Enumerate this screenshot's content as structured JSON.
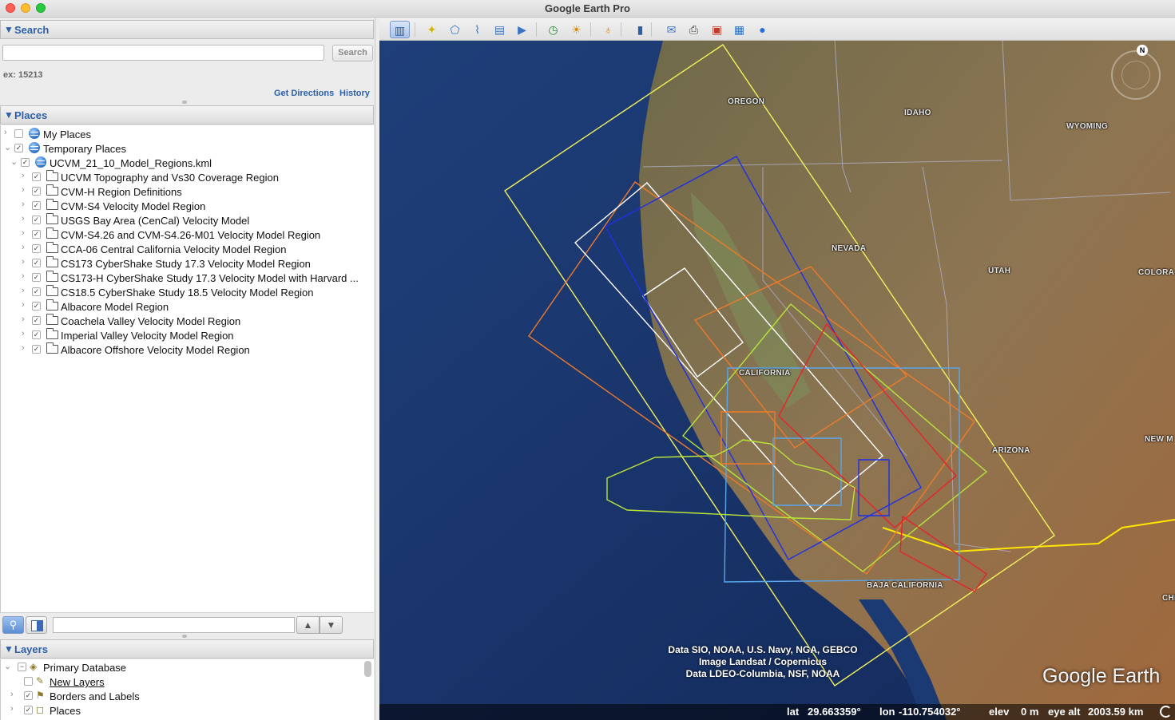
{
  "window": {
    "title": "Google Earth Pro"
  },
  "search": {
    "header": "Search",
    "placeholder": "",
    "button": "Search",
    "hint": "ex: 15213",
    "get_directions": "Get Directions",
    "history": "History"
  },
  "places": {
    "header": "Places",
    "items": [
      {
        "label": "My Places",
        "level": 0,
        "icon": "my-places-globe-icon",
        "expanded": false
      },
      {
        "label": "Temporary Places",
        "level": 0,
        "icon": "temporary-places-icon",
        "expanded": true
      },
      {
        "label": "UCVM_21_10_Model_Regions.kml",
        "level": 1,
        "icon": "kml-globe-icon",
        "expanded": true
      },
      {
        "label": "UCVM Topography and Vs30 Coverage Region",
        "level": 2,
        "icon": "folder-icon"
      },
      {
        "label": "CVM-H Region Definitions",
        "level": 2,
        "icon": "folder-icon"
      },
      {
        "label": "CVM-S4 Velocity Model Region",
        "level": 2,
        "icon": "folder-icon"
      },
      {
        "label": "USGS Bay Area (CenCal) Velocity Model",
        "level": 2,
        "icon": "folder-icon"
      },
      {
        "label": "CVM-S4.26 and CVM-S4.26-M01 Velocity Model Region",
        "level": 2,
        "icon": "folder-icon"
      },
      {
        "label": "CCA-06 Central California Velocity Model Region",
        "level": 2,
        "icon": "folder-icon"
      },
      {
        "label": "CS173 CyberShake Study 17.3 Velocity Model Region",
        "level": 2,
        "icon": "folder-icon"
      },
      {
        "label": "CS173-H CyberShake Study 17.3 Velocity Model with Harvard ...",
        "level": 2,
        "icon": "folder-icon"
      },
      {
        "label": "CS18.5 CyberShake Study 18.5 Velocity Model Region",
        "level": 2,
        "icon": "folder-icon"
      },
      {
        "label": "Albacore Model Region",
        "level": 2,
        "icon": "folder-icon"
      },
      {
        "label": "Coachela Valley Velocity Model Region",
        "level": 2,
        "icon": "folder-icon"
      },
      {
        "label": "Imperial Valley Velocity Model Region",
        "level": 2,
        "icon": "folder-icon"
      },
      {
        "label": "Albacore Offshore Velocity Model Region",
        "level": 2,
        "icon": "folder-icon"
      }
    ]
  },
  "layers": {
    "header": "Layers",
    "items": [
      {
        "label": "Primary Database",
        "level": 0,
        "icon": "database-layers-icon",
        "link": false
      },
      {
        "label": "New Layers",
        "level": 1,
        "icon": "pencil-icon",
        "link": true
      },
      {
        "label": "Borders and Labels",
        "level": 1,
        "icon": "flag-icon",
        "link": false
      },
      {
        "label": "Places",
        "level": 1,
        "icon": "places-icon",
        "link": false
      }
    ]
  },
  "toolbar": {
    "icons": [
      "sidebar-toggle-icon",
      "placemark-icon",
      "polygon-icon",
      "path-icon",
      "overlay-icon",
      "tour-icon",
      "historical-imagery-icon",
      "sunlight-icon",
      "planets-icon",
      "ruler-icon",
      "email-icon",
      "print-icon",
      "save-image-icon",
      "map-icon",
      "google-earth-icon"
    ]
  },
  "map": {
    "labels": [
      "OREGON",
      "IDAHO",
      "WYOMING",
      "NEVADA",
      "UTAH",
      "COLORA",
      "CALIFORNIA",
      "ARIZONA",
      "NEW M",
      "BAJA CALIFORNIA",
      "CHI"
    ],
    "attribution": [
      "Data SIO, NOAA, U.S. Navy, NGA, GEBCO",
      "Image Landsat / Copernicus",
      "Data LDEO-Columbia, NSF, NOAA"
    ],
    "logo": "Google Earth",
    "compass_north": "N",
    "status": {
      "lat_label": "lat",
      "lat": "29.663359°",
      "lon_label": "lon",
      "lon": "-110.754032°",
      "elev_label": "elev",
      "elev": "0 m",
      "eye_alt_label": "eye alt",
      "eye_alt": "2003.59 km"
    },
    "region_colors": {
      "yellow": "#f2f25a",
      "orange": "#ee7a2a",
      "white": "#ffffff",
      "blue": "#1f2fe6",
      "light_blue": "#5aa6e8",
      "green": "#b9e43a",
      "red": "#e8222a",
      "border": "#ffe600"
    }
  }
}
